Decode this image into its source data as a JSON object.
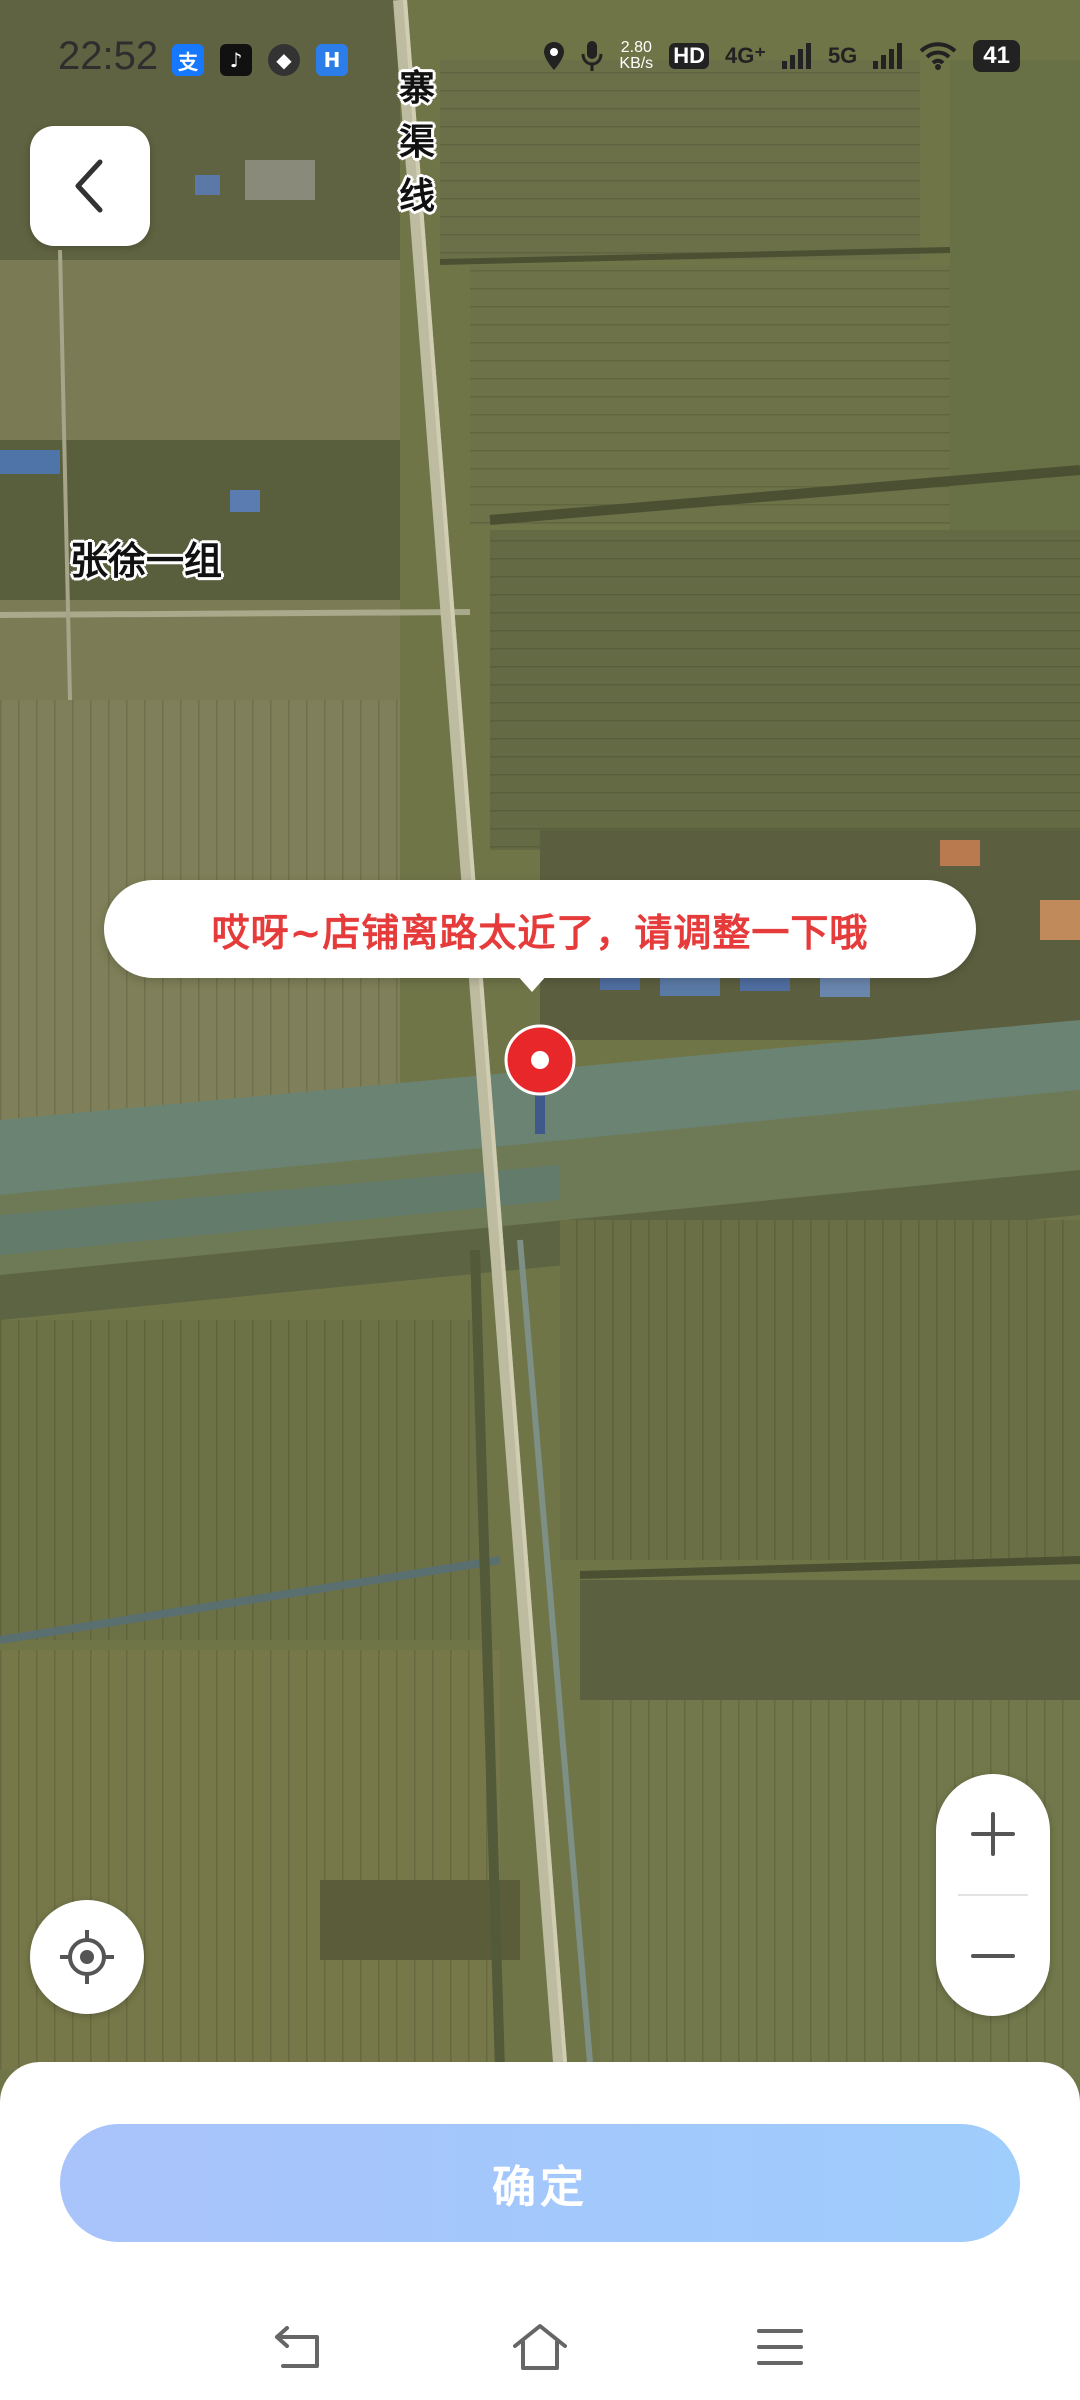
{
  "status_bar": {
    "time": "22:52",
    "app_icons": [
      {
        "name": "alipay-icon",
        "glyph": "支",
        "color": "#1677ff"
      },
      {
        "name": "tiktok-icon",
        "glyph": "♪",
        "color": "#111111"
      },
      {
        "name": "navigation-app-icon",
        "glyph": "◆",
        "color": "#333333"
      },
      {
        "name": "browser-app-icon",
        "glyph": "H",
        "color": "#2b7de9"
      }
    ],
    "net_speed_value": "2.80",
    "net_speed_unit": "KB/s",
    "hd_label": "HD",
    "sim1_label": "4G⁺",
    "sim2_label": "5G",
    "battery": "41"
  },
  "map": {
    "road_label": "寨渠线",
    "village_label": "张徐一组"
  },
  "tooltip": {
    "message": "哎呀~店铺离路太近了，请调整一下哦",
    "color": "#e63b3b"
  },
  "pin": {
    "color": "#e8272b"
  },
  "controls": {
    "zoom_in_symbol": "+",
    "zoom_out_symbol": "−"
  },
  "bottom_panel": {
    "confirm_label": "确定",
    "accent_color": "#a6c6fb"
  }
}
